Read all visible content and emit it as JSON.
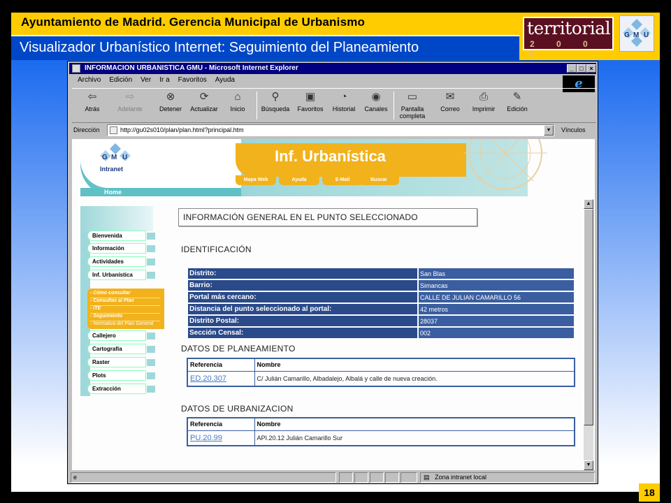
{
  "slide": {
    "org_title": "Ayuntamiento de Madrid. Gerencia Municipal de Urbanismo",
    "subtitle": "Visualizador Urbanístico Internet: Seguimiento del Planeamiento",
    "logo_territorial_word": "territorial",
    "logo_territorial_year": "2 0 0 0",
    "logo_gmu": "GMU",
    "page_number": "18",
    "colors": {
      "header": "#ffcc00",
      "subtitle_bar": "#0047c8"
    }
  },
  "browser": {
    "window_title": "INFORMACION URBANISTICA GMU - Microsoft Internet Explorer",
    "menu": [
      "Archivo",
      "Edición",
      "Ver",
      "Ir a",
      "Favoritos",
      "Ayuda"
    ],
    "toolbar": [
      {
        "label": "Atrás",
        "icon": "back-arrow-icon"
      },
      {
        "label": "Adelante",
        "icon": "forward-arrow-icon"
      },
      {
        "label": "Detener",
        "icon": "stop-icon"
      },
      {
        "label": "Actualizar",
        "icon": "refresh-icon"
      },
      {
        "label": "Inicio",
        "icon": "home-icon"
      },
      {
        "label": "Búsqueda",
        "icon": "search-icon"
      },
      {
        "label": "Favoritos",
        "icon": "favorites-icon"
      },
      {
        "label": "Historial",
        "icon": "history-icon"
      },
      {
        "label": "Canales",
        "icon": "channels-icon"
      },
      {
        "label": "Pantalla completa",
        "icon": "fullscreen-icon"
      },
      {
        "label": "Correo",
        "icon": "mail-icon"
      },
      {
        "label": "Imprimir",
        "icon": "print-icon"
      },
      {
        "label": "Edición",
        "icon": "edit-icon"
      }
    ],
    "address_label": "Dirección",
    "address_value": "http://gu02s010/plan/plan.html?principal.htm",
    "links_label": "Vínculos",
    "status_zone": "Zona intranet local"
  },
  "page": {
    "gmu_logo_text": "GMU",
    "intranet_label": "Intranet",
    "home_label": "Home",
    "banner_title": "Inf. Urbanística",
    "nav_tabs": [
      "Mapa Web",
      "Ayuda",
      "E-Mail",
      "Buscar"
    ],
    "sidebar_items_top": [
      "Bienvenida",
      "Información",
      "Actividades",
      "Inf. Urbanística"
    ],
    "submenu_items": [
      "- Cómo consultar",
      "- Consultas al Plan",
      "- ITE",
      "- Seguimiento",
      "- Normativa del Plan General"
    ],
    "sidebar_items_bottom": [
      "Callejero",
      "Cartografía",
      "Raster",
      "Plots",
      "Extracción"
    ],
    "info_title": "INFORMACIÓN GENERAL EN EL PUNTO SELECCIONADO",
    "identificacion_title": "IDENTIFICACIÓN",
    "identificacion_rows": [
      {
        "key": "Distrito:",
        "value": "San Blas"
      },
      {
        "key": "Barrio:",
        "value": "Simancas"
      },
      {
        "key": "Portal más cercano:",
        "value": "CALLE DE JULIAN CAMARILLO 56"
      },
      {
        "key": "Distancia del punto seleccionado al portal:",
        "value": "42 metros"
      },
      {
        "key": "Distrito Postal:",
        "value": "28037"
      },
      {
        "key": "Sección Censal:",
        "value": "002"
      }
    ],
    "planeamiento_title": "DATOS DE PLANEAMIENTO",
    "planeamiento_headers": [
      "Referencia",
      "Nombre"
    ],
    "planeamiento_row": {
      "ref": "ED.20.307",
      "nombre": "C/ Julián Camarillo, Albadalejo, Albalá y calle de nueva creación."
    },
    "urbanizacion_title": "DATOS DE URBANIZACION",
    "urbanizacion_headers": [
      "Referencia",
      "Nombre"
    ],
    "urbanizacion_row": {
      "ref": "PU.20.99",
      "nombre": "API.20.12 Julián Camarillo Sur"
    }
  }
}
